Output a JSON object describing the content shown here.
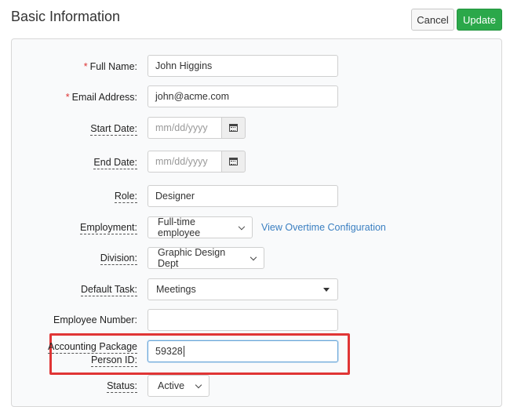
{
  "header": {
    "title": "Basic Information",
    "cancel_label": "Cancel",
    "update_label": "Update"
  },
  "colors": {
    "accent_green": "#2ba84a",
    "link_blue": "#3a7fc1",
    "required_red": "#d33333",
    "highlight_red": "#e03535"
  },
  "form": {
    "full_name": {
      "label": "Full Name:",
      "required": "*",
      "value": "John Higgins"
    },
    "email": {
      "label": "Email Address:",
      "required": "*",
      "value": "john@acme.com"
    },
    "start_date": {
      "label": "Start Date:",
      "placeholder": "mm/dd/yyyy"
    },
    "end_date": {
      "label": "End Date:",
      "placeholder": "mm/dd/yyyy"
    },
    "role": {
      "label": "Role:",
      "value": "Designer"
    },
    "employment": {
      "label": "Employment:",
      "value": "Full-time employee",
      "link": "View Overtime Configuration"
    },
    "division": {
      "label": "Division:",
      "value": "Graphic Design Dept"
    },
    "default_task": {
      "label": "Default Task:",
      "value": "Meetings"
    },
    "employee_number": {
      "label": "Employee Number:",
      "value": ""
    },
    "accounting_id": {
      "label_line1": "Accounting Package",
      "label_line2": "Person ID:",
      "value": "59328"
    },
    "status": {
      "label": "Status:",
      "value": "Active"
    }
  }
}
